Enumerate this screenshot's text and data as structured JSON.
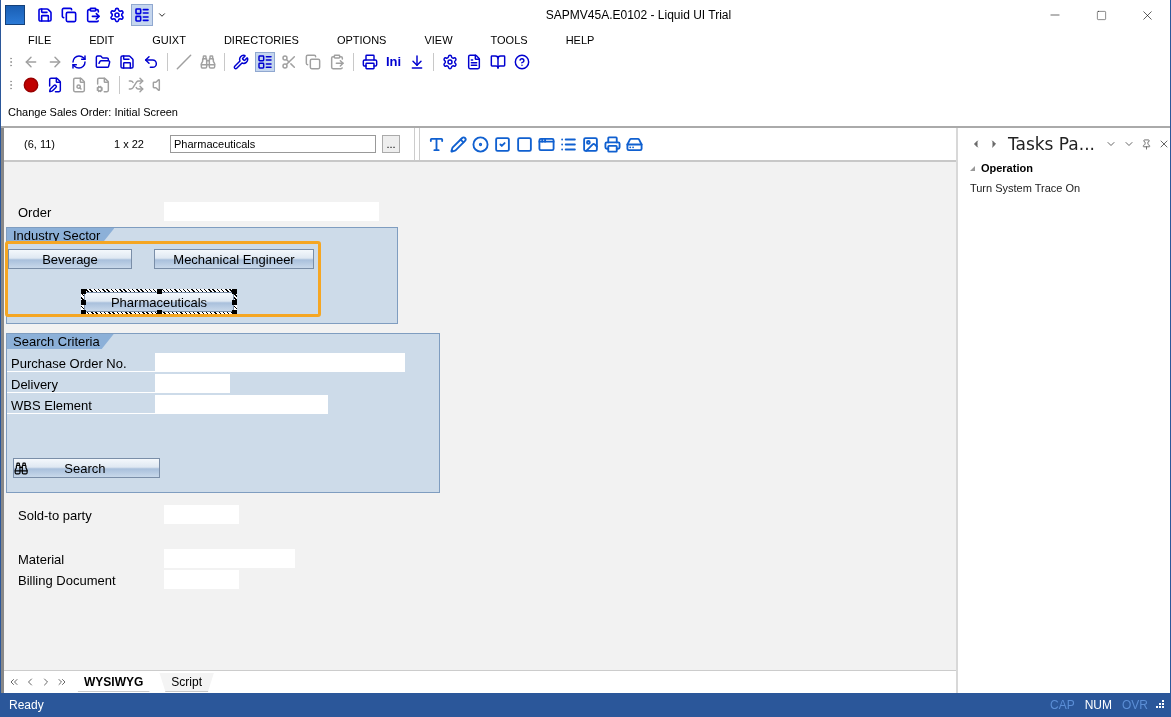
{
  "window": {
    "title": "SAPMV45A.E0102 - Liquid UI Trial"
  },
  "quick_access": [
    {
      "pressed": false
    },
    {
      "pressed": false
    },
    {
      "pressed": false
    },
    {
      "pressed": false
    },
    {
      "pressed": true
    }
  ],
  "menu": [
    "FILE",
    "EDIT",
    "GUIXT",
    "DIRECTORIES",
    "OPTIONS",
    "VIEW",
    "TOOLS",
    "HELP"
  ],
  "toolbar": [
    {
      "kind": "icon",
      "disabled": true,
      "pressed": false
    },
    {
      "kind": "icon",
      "disabled": true,
      "pressed": false
    },
    {
      "kind": "icon",
      "disabled": false,
      "pressed": false
    },
    {
      "kind": "icon",
      "disabled": false,
      "pressed": false
    },
    {
      "kind": "icon",
      "disabled": false,
      "pressed": false
    },
    {
      "kind": "icon",
      "disabled": false,
      "pressed": false
    },
    {
      "kind": "separator"
    },
    {
      "kind": "icon",
      "disabled": true,
      "pressed": false
    },
    {
      "kind": "icon",
      "disabled": true,
      "pressed": false
    },
    {
      "kind": "separator"
    },
    {
      "kind": "icon",
      "disabled": false,
      "pressed": false
    },
    {
      "kind": "icon",
      "disabled": false,
      "pressed": true
    },
    {
      "kind": "icon",
      "disabled": true,
      "pressed": false
    },
    {
      "kind": "icon",
      "disabled": true,
      "pressed": false
    },
    {
      "kind": "icon",
      "disabled": true,
      "pressed": false
    },
    {
      "kind": "separator"
    },
    {
      "kind": "icon",
      "disabled": false,
      "pressed": false
    },
    {
      "kind": "text",
      "label": "Ini",
      "disabled": false,
      "pressed": false
    },
    {
      "kind": "icon",
      "disabled": false,
      "pressed": false
    },
    {
      "kind": "separator"
    },
    {
      "kind": "icon",
      "disabled": false,
      "pressed": false
    },
    {
      "kind": "icon",
      "disabled": false,
      "pressed": false
    },
    {
      "kind": "icon",
      "disabled": false,
      "pressed": false
    },
    {
      "kind": "icon",
      "disabled": false,
      "pressed": false
    }
  ],
  "toolbar2": [
    {
      "kind": "icon",
      "disabled": false
    },
    {
      "kind": "icon",
      "disabled": false
    },
    {
      "kind": "icon",
      "disabled": true
    },
    {
      "kind": "icon",
      "disabled": true
    },
    {
      "kind": "separator"
    },
    {
      "kind": "icon",
      "disabled": true
    },
    {
      "kind": "icon",
      "disabled": true
    }
  ],
  "screen_title": "Change Sales Order: Initial Screen",
  "designer": {
    "position": "(6, 11)",
    "size": "1 x 22",
    "element_text": "Pharmaceuticals",
    "browse_button": "..."
  },
  "canvas": {
    "fields_top": [
      {
        "label": "Order"
      }
    ],
    "industry_sector": {
      "title": "Industry Sector",
      "buttons": [
        {
          "label": "Beverage",
          "selected": false
        },
        {
          "label": "Mechanical Engineer",
          "selected": false
        },
        {
          "label": "Pharmaceuticals",
          "selected": true
        }
      ]
    },
    "search_criteria": {
      "title": "Search Criteria",
      "fields": [
        {
          "label": "Purchase Order No."
        },
        {
          "label": "Delivery"
        },
        {
          "label": "WBS Element"
        }
      ],
      "button": "Search"
    },
    "fields_bottom": [
      {
        "label": "Sold-to party"
      },
      {
        "label": "Material"
      },
      {
        "label": "Billing Document"
      }
    ]
  },
  "sheet_tabs": [
    {
      "label": "WYSIWYG",
      "selected": true
    },
    {
      "label": "Script",
      "selected": false
    }
  ],
  "tasks_pane": {
    "title": "Tasks Pa...",
    "section": {
      "title": "Operation",
      "expanded": true
    },
    "items": [
      "Turn System Trace On"
    ]
  },
  "status_bar": {
    "text": "Ready",
    "indicators": [
      {
        "label": "CAP",
        "on": false
      },
      {
        "label": "NUM",
        "on": true
      },
      {
        "label": "OVR",
        "on": false
      }
    ]
  }
}
